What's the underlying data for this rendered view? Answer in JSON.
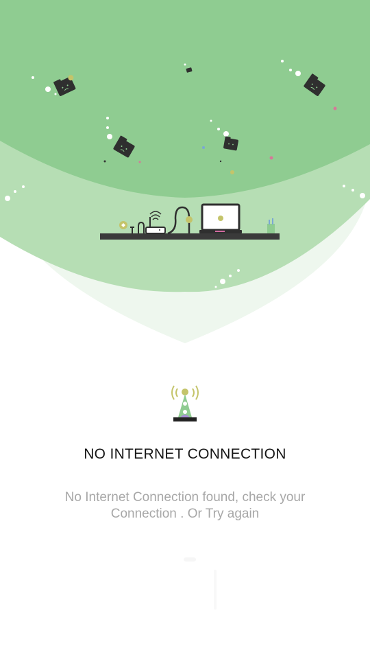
{
  "screen": {
    "title": "NO INTERNET CONNECTION",
    "message": "No Internet Connection found, check your Connection . Or Try again"
  },
  "illustration": {
    "scene": "devices-on-shelf",
    "icons": [
      "folder-icon",
      "router-icon",
      "laptop-icon",
      "plug-icon",
      "plant-icon",
      "signal-tower-icon"
    ]
  },
  "colors": {
    "accent": "#8fcc91",
    "accent_light": "#b6deb4",
    "accent_pale": "#eef7ee",
    "dark": "#2f2f2f",
    "title_text": "#161616",
    "body_text": "#a7a7a7",
    "badge": "#c4c46a",
    "laptop_accent": "#d36aa0"
  }
}
